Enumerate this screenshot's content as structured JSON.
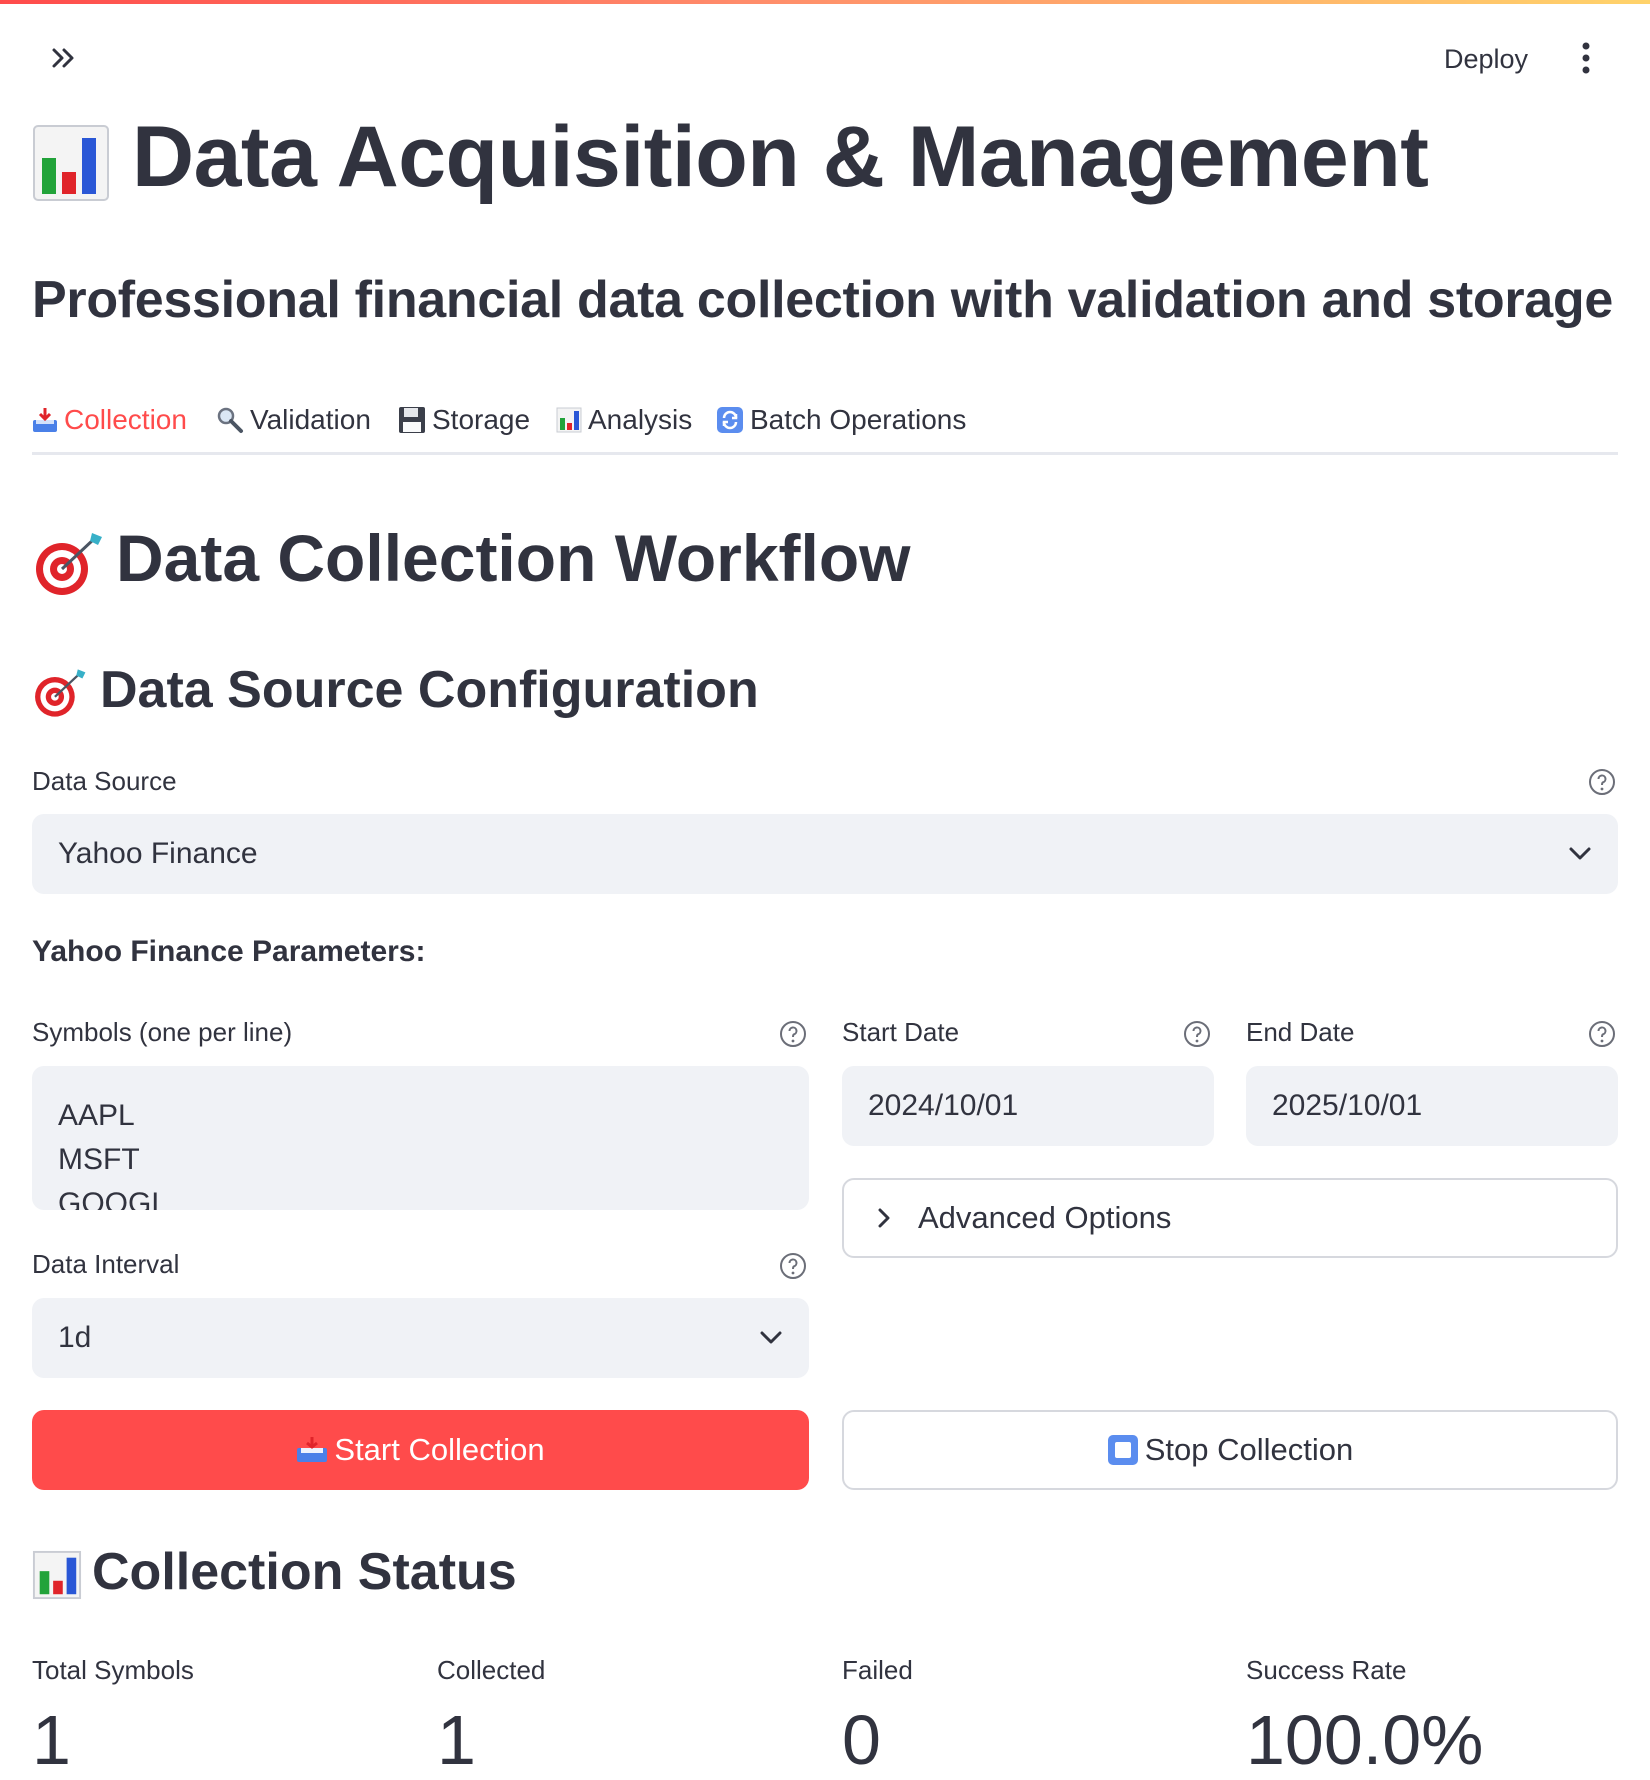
{
  "header": {
    "deploy_label": "Deploy"
  },
  "page": {
    "title": "Data Acquisition & Management",
    "subtitle": "Professional financial data collection with validation and storage"
  },
  "tabs": [
    {
      "label": "Collection",
      "icon": "inbox-tray-icon",
      "active": true
    },
    {
      "label": "Validation",
      "icon": "magnifier-icon",
      "active": false
    },
    {
      "label": "Storage",
      "icon": "floppy-disk-icon",
      "active": false
    },
    {
      "label": "Analysis",
      "icon": "bar-chart-icon",
      "active": false
    },
    {
      "label": "Batch Operations",
      "icon": "refresh-icon",
      "active": false
    }
  ],
  "workflow": {
    "heading": "Data Collection Workflow",
    "config_heading": "Data Source Configuration",
    "data_source_label": "Data Source",
    "data_source_value": "Yahoo Finance",
    "params_label": "Yahoo Finance Parameters:",
    "symbols_label": "Symbols (one per line)",
    "symbols_value": "AAPL\nMSFT\nGOOGL",
    "start_date_label": "Start Date",
    "start_date_value": "2024/10/01",
    "end_date_label": "End Date",
    "end_date_value": "2025/10/01",
    "advanced_label": "Advanced Options",
    "interval_label": "Data Interval",
    "interval_value": "1d",
    "start_button": "Start Collection",
    "stop_button": "Stop Collection"
  },
  "status": {
    "heading": "Collection Status",
    "metrics": [
      {
        "label": "Total Symbols",
        "value": "1"
      },
      {
        "label": "Collected",
        "value": "1"
      },
      {
        "label": "Failed",
        "value": "0"
      },
      {
        "label": "Success Rate",
        "value": "100.0%"
      }
    ]
  },
  "colors": {
    "accent": "#ff4b4b",
    "input_bg": "#f0f2f6",
    "text": "#31333f"
  }
}
